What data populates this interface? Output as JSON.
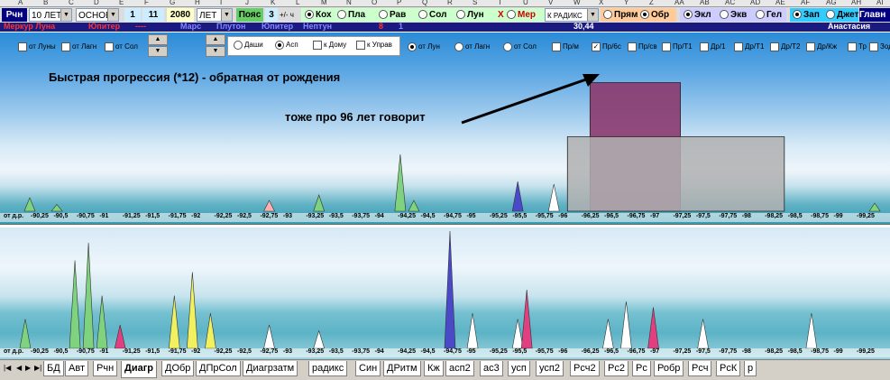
{
  "column_letters": [
    "A",
    "B",
    "C",
    "D",
    "E",
    "F",
    "G",
    "H",
    "I",
    "J",
    "K",
    "L",
    "M",
    "N",
    "O",
    "P",
    "Q",
    "R",
    "S",
    "T",
    "U",
    "V",
    "W",
    "X",
    "Y",
    "Z",
    "AA",
    "AB",
    "AC",
    "AD",
    "AE",
    "AF",
    "AG",
    "AH",
    "AI"
  ],
  "toolbar": {
    "mode_button": "Рчн",
    "period_select": "10 ЛЕТ",
    "base_select": "ОСНОВН",
    "num1": "1",
    "num2": "11",
    "year": "2080",
    "unit_select": "ЛЕТ",
    "belt_button": "Пояс",
    "num3": "3",
    "plusminus": "+/- ч",
    "planet_radios": [
      "Кох",
      "Пла",
      "Рав",
      "Сол",
      "Лун"
    ],
    "x_mark": "Х",
    "mer_label": "Мер",
    "radix_select": "К РАДИКС",
    "direction_radios": [
      "Прям",
      "Обр"
    ],
    "coord_radios": [
      "Экл",
      "Экв",
      "Гел"
    ],
    "save_radios": [
      "Зап",
      "Джет"
    ],
    "main_button": "Главн"
  },
  "row2": {
    "left_planets": "Меркур Луна",
    "jupiter1": "Юпитер",
    "dashes": "----",
    "mars": "Марс",
    "pluto": "Плутон",
    "jupiter2": "Юпитер",
    "neptune": "Нептун",
    "num8": "8",
    "num1": "1",
    "value": "30,44",
    "name": "Анастасия"
  },
  "options": {
    "from_moon": "от Луны",
    "from_lagn": "от Лагн",
    "from_sun": "от Сол",
    "radios_box": [
      "Даши",
      "Асп",
      "к Дому",
      "к Управ"
    ],
    "series_opts": [
      "от Лун",
      "от Лагн",
      "от Сол",
      "Пр/м",
      "Пр/6с",
      "Пр/св",
      "Пр/Т1",
      "Др/1",
      "Др/Т1",
      "Др/Т2",
      "Др/Кж",
      "Тр",
      "Зод"
    ]
  },
  "chart1": {
    "title_annotation": "Быстрая прогрессия (*12) - обратная от рождения",
    "arrow_annotation": "тоже про 96 лет говорит",
    "x_label_prefix": "от д.р.",
    "ticks": [
      "-90,25",
      "-90,5",
      "-90,75",
      "-91",
      "-91,25",
      "-91,5",
      "-91,75",
      "-92",
      "-92,25",
      "-92,5",
      "-92,75",
      "-93",
      "-93,25",
      "-93,5",
      "-93,75",
      "-94",
      "-94,25",
      "-94,5",
      "-94,75",
      "-95",
      "-95,25",
      "-95,5",
      "-95,75",
      "-96",
      "-96,25",
      "-96,5",
      "-96,75",
      "-97",
      "-97,25",
      "-97,5",
      "-97,75",
      "-98",
      "-98,25",
      "-98,5",
      "-98,75",
      "-99",
      "-99,25"
    ]
  },
  "chart2": {
    "x_label_prefix": "от д.р.",
    "ticks": [
      "-90,25",
      "-90,5",
      "-90,75",
      "-91",
      "-91,25",
      "-91,5",
      "-91,75",
      "-92",
      "-92,25",
      "-92,5",
      "-92,75",
      "-93",
      "-93,25",
      "-93,5",
      "-93,75",
      "-94",
      "-94,25",
      "-94,5",
      "-94,75",
      "-95",
      "-95,25",
      "-95,5",
      "-95,75",
      "-96",
      "-96,25",
      "-96,5",
      "-96,75",
      "-97",
      "-97,25",
      "-97,5",
      "-97,75",
      "-98",
      "-98,25",
      "-98,5",
      "-98,75",
      "-99",
      "-99,25"
    ]
  },
  "chart_data": [
    {
      "type": "area",
      "title": "Быстрая прогрессия (*12) - обратная от рождения",
      "xlabel": "от д.р.",
      "x_range": [
        -90.25,
        -99.25
      ],
      "series": [
        {
          "color": "#8c3a6e",
          "x": [
            -96.3,
            -96.3,
            -97.3,
            -97.3
          ],
          "y": [
            0,
            0.95,
            0.95,
            0
          ],
          "label_note": "block"
        },
        {
          "color": "#b0b0b0",
          "x": [
            -96.05,
            -96.05,
            -98.45,
            -98.45
          ],
          "y": [
            0,
            0.55,
            0.55,
            0
          ]
        }
      ],
      "spikes": [
        {
          "x": -90.1,
          "y": 0.1,
          "color": "#7fd37f"
        },
        {
          "x": -90.4,
          "y": 0.05,
          "color": "#7fd37f"
        },
        {
          "x": -92.75,
          "y": 0.08,
          "color": "#ffb0b0"
        },
        {
          "x": -93.3,
          "y": 0.12,
          "color": "#7fd37f"
        },
        {
          "x": -94.2,
          "y": 0.42,
          "color": "#7fd37f"
        },
        {
          "x": -94.35,
          "y": 0.08,
          "color": "#7fd37f"
        },
        {
          "x": -95.5,
          "y": 0.22,
          "color": "#4a4ac8"
        },
        {
          "x": -95.9,
          "y": 0.2,
          "color": "#ffffff"
        },
        {
          "x": -99.45,
          "y": 0.06,
          "color": "#7fd37f"
        }
      ]
    },
    {
      "type": "area",
      "xlabel": "от д.р.",
      "x_range": [
        -90.25,
        -99.25
      ],
      "spikes": [
        {
          "x": -90.05,
          "y": 0.25,
          "color": "#7fd37f"
        },
        {
          "x": -90.6,
          "y": 0.75,
          "color": "#7fd37f"
        },
        {
          "x": -90.75,
          "y": 0.9,
          "color": "#7fd37f"
        },
        {
          "x": -90.9,
          "y": 0.45,
          "color": "#7fd37f"
        },
        {
          "x": -91.1,
          "y": 0.2,
          "color": "#e04080"
        },
        {
          "x": -91.7,
          "y": 0.45,
          "color": "#f0f060"
        },
        {
          "x": -91.9,
          "y": 0.65,
          "color": "#f0f060"
        },
        {
          "x": -92.1,
          "y": 0.3,
          "color": "#f0f060"
        },
        {
          "x": -92.75,
          "y": 0.2,
          "color": "#ffffff"
        },
        {
          "x": -93.3,
          "y": 0.15,
          "color": "#ffffff"
        },
        {
          "x": -94.75,
          "y": 1.0,
          "color": "#4a4ac8"
        },
        {
          "x": -95.0,
          "y": 0.3,
          "color": "#ffffff"
        },
        {
          "x": -95.5,
          "y": 0.25,
          "color": "#ffffff"
        },
        {
          "x": -95.6,
          "y": 0.5,
          "color": "#e04080"
        },
        {
          "x": -96.5,
          "y": 0.25,
          "color": "#ffffff"
        },
        {
          "x": -96.7,
          "y": 0.4,
          "color": "#ffffff"
        },
        {
          "x": -97.0,
          "y": 0.35,
          "color": "#e04080"
        },
        {
          "x": -97.55,
          "y": 0.25,
          "color": "#ffffff"
        },
        {
          "x": -98.75,
          "y": 0.3,
          "color": "#ffffff"
        }
      ]
    }
  ],
  "sheet_tabs": [
    "БД",
    "Авт",
    "Рчн",
    "Диагр",
    "ДОбр",
    "ДПрСол",
    "Диагрзатм",
    "радикс",
    "Син",
    "ДРитм",
    "Кж",
    "асп2",
    "ас3",
    "усп",
    "усп2",
    "Рсч2",
    "Рс2",
    "Рс",
    "Робр",
    "Рсч",
    "РсК",
    "р"
  ],
  "active_tab": "Диагр",
  "colors": {
    "title_bar_blue": "#1a1a80",
    "pink_block": "#8c3a6e",
    "gray_block": "#b0b0b0"
  }
}
